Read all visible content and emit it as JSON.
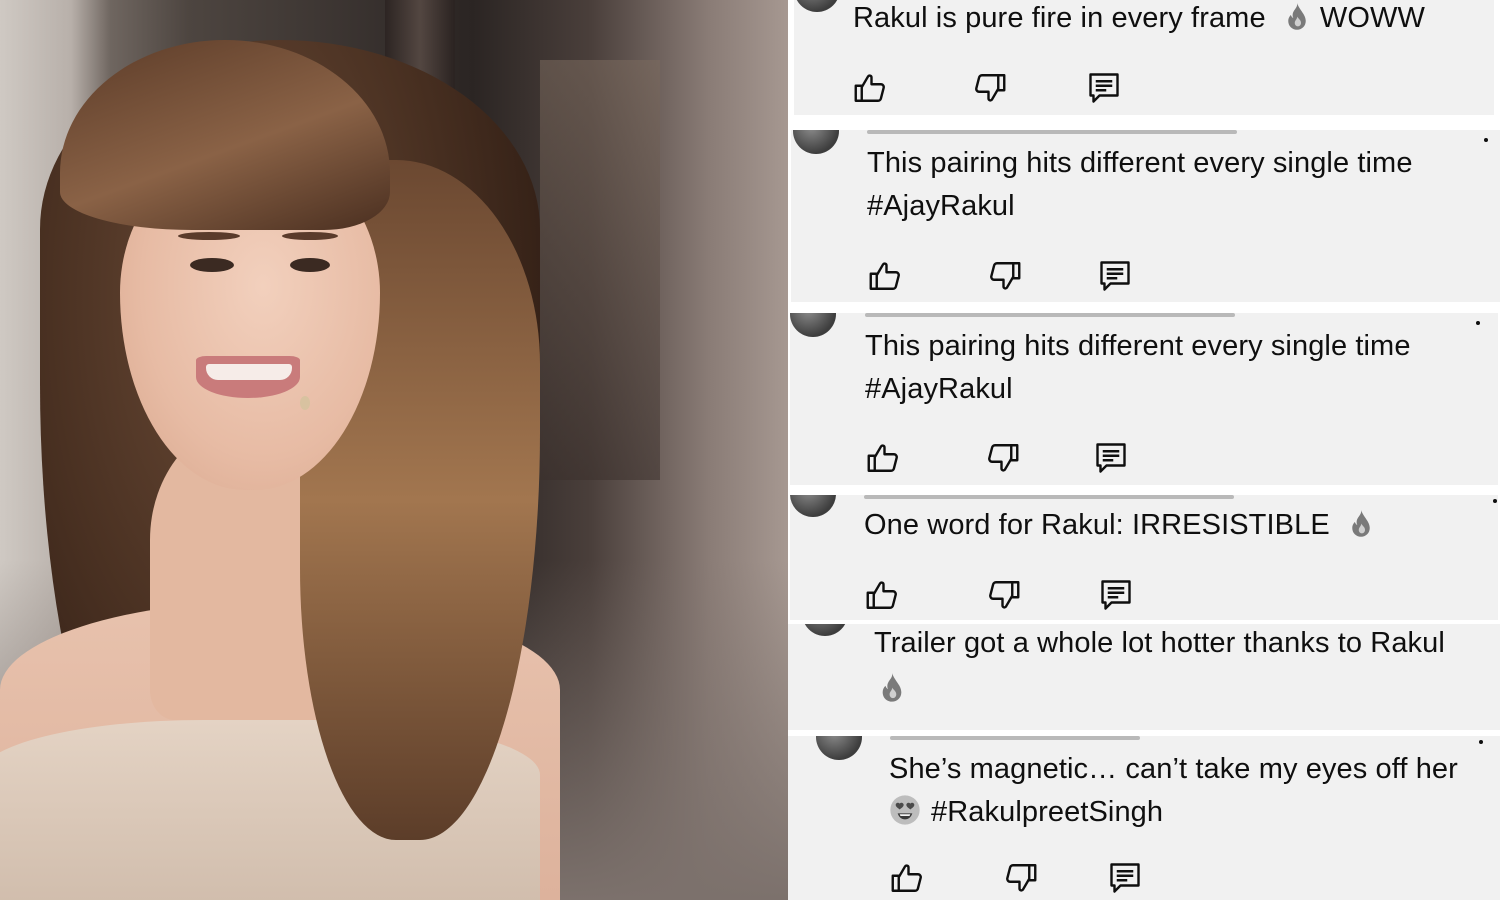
{
  "comments": [
    {
      "text": [
        "Rakul is pure fire in every frame",
        "WOWW"
      ],
      "emoji_inline": "fire"
    },
    {
      "text": [
        "This pairing hits different every single time",
        "#AjayRakul"
      ]
    },
    {
      "text": [
        "This pairing hits different every single time",
        "#AjayRakul"
      ]
    },
    {
      "text": [
        "One word for Rakul: IRRESISTIBLE"
      ],
      "emoji_inline": "fire"
    },
    {
      "text": [
        "Trailer got a whole lot hotter thanks to Rakul"
      ],
      "emoji_line": "fire"
    },
    {
      "text": [
        "She’s magnetic… can’t take my eyes off her",
        "#RakulpreetSingh"
      ],
      "emoji_prefix": "heart-eyes"
    }
  ],
  "colors": {
    "card_bg": "#f1f1f1",
    "text": "#0f0f0f",
    "icon": "#0f0f0f",
    "fire": "#808080"
  },
  "icons": [
    "thumbs-up-icon",
    "thumbs-down-icon",
    "reply-icon",
    "more-vertical-icon"
  ]
}
